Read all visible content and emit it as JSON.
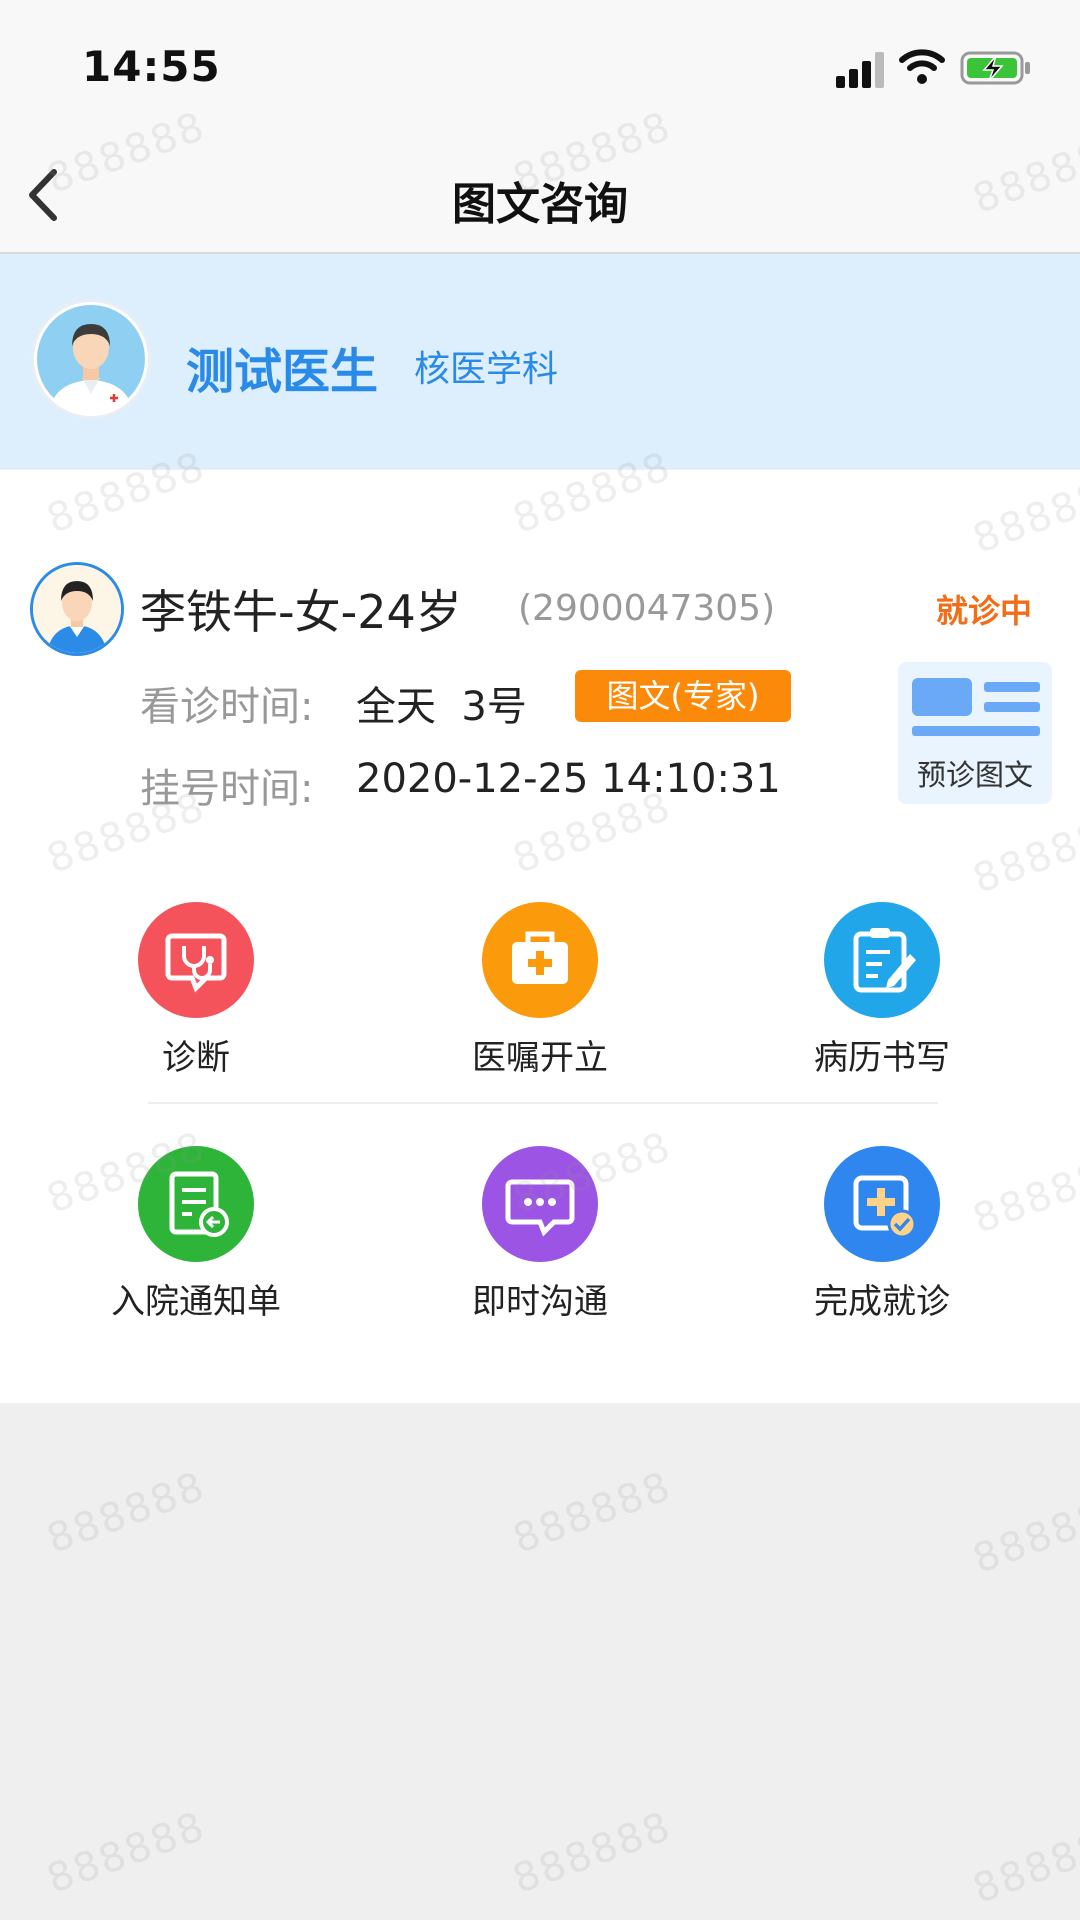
{
  "status_bar": {
    "time": "14:55"
  },
  "nav": {
    "title": "图文咨询"
  },
  "doctor": {
    "name": "测试医生",
    "department": "核医学科"
  },
  "patient": {
    "name_line": "李铁牛-女-24岁",
    "id": "(2900047305)",
    "status": "就诊中",
    "visit_time_label": "看诊时间:",
    "visit_time_value": "全天  3号",
    "tag": "图文(专家)",
    "register_time_label": "挂号时间:",
    "register_time_value": "2020-12-25 14:10:31",
    "preview_button": "预诊图文"
  },
  "actions": [
    {
      "label": "诊断",
      "icon": "stethoscope-chat-icon",
      "color": "#f4535c"
    },
    {
      "label": "医嘱开立",
      "icon": "medical-kit-icon",
      "color": "#fb9a0a"
    },
    {
      "label": "病历书写",
      "icon": "clipboard-edit-icon",
      "color": "#22a6ea"
    },
    {
      "label": "入院通知单",
      "icon": "document-return-icon",
      "color": "#2fb43a"
    },
    {
      "label": "即时沟通",
      "icon": "chat-bubble-icon",
      "color": "#9c54e4"
    },
    {
      "label": "完成就诊",
      "icon": "medical-check-icon",
      "color": "#2f86ee"
    }
  ],
  "watermark": "888888",
  "colors": {
    "accent": "#2a8ae8",
    "status": "#f36d18",
    "tag": "#fb8a0a",
    "header_bg": "#ddeefc"
  }
}
